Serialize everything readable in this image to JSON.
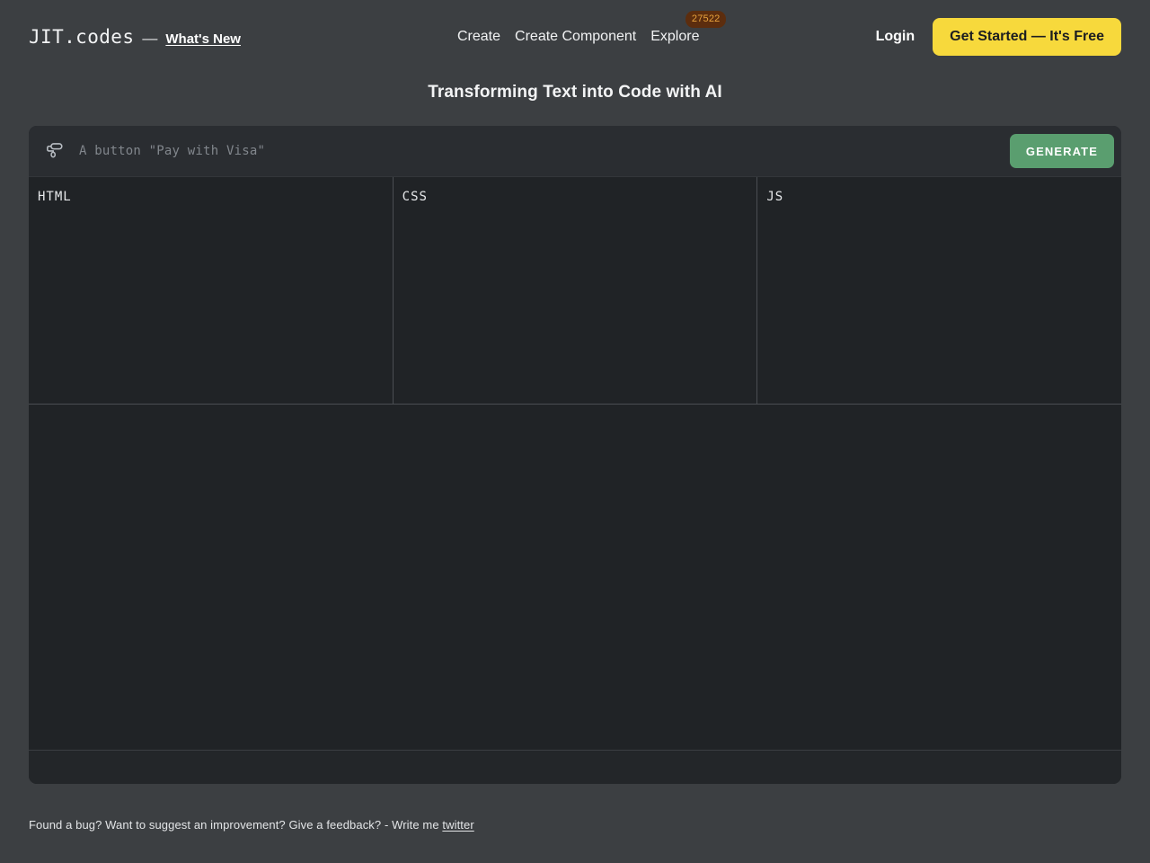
{
  "header": {
    "logo": "JIT.codes",
    "separator": "—",
    "whats_new_label": "What's New",
    "nav": [
      {
        "label": "Create",
        "badge": null
      },
      {
        "label": "Create Component",
        "badge": null
      },
      {
        "label": "Explore",
        "badge": "27522"
      }
    ],
    "login_label": "Login",
    "cta_label": "Get Started — It's Free"
  },
  "page": {
    "title": "Transforming Text into Code with AI"
  },
  "prompt": {
    "icon": "paint-roller-icon",
    "placeholder": "A button \"Pay with Visa\"",
    "value": "",
    "generate_label": "GENERATE"
  },
  "editors": [
    {
      "label": "HTML",
      "code": ""
    },
    {
      "label": "CSS",
      "code": ""
    },
    {
      "label": "JS",
      "code": ""
    }
  ],
  "footer": {
    "text": "Found a bug? Want to suggest an improvement? Give a feedback? - Write me ",
    "link_label": "twitter"
  },
  "colors": {
    "page_background": "#3c3f42",
    "card_background": "#202326",
    "prompt_background": "#2a2d31",
    "cta_yellow": "#f7d93c",
    "generate_green": "#5a9e6f",
    "badge_background": "#5c2d0e",
    "badge_text": "#e8a33d"
  }
}
